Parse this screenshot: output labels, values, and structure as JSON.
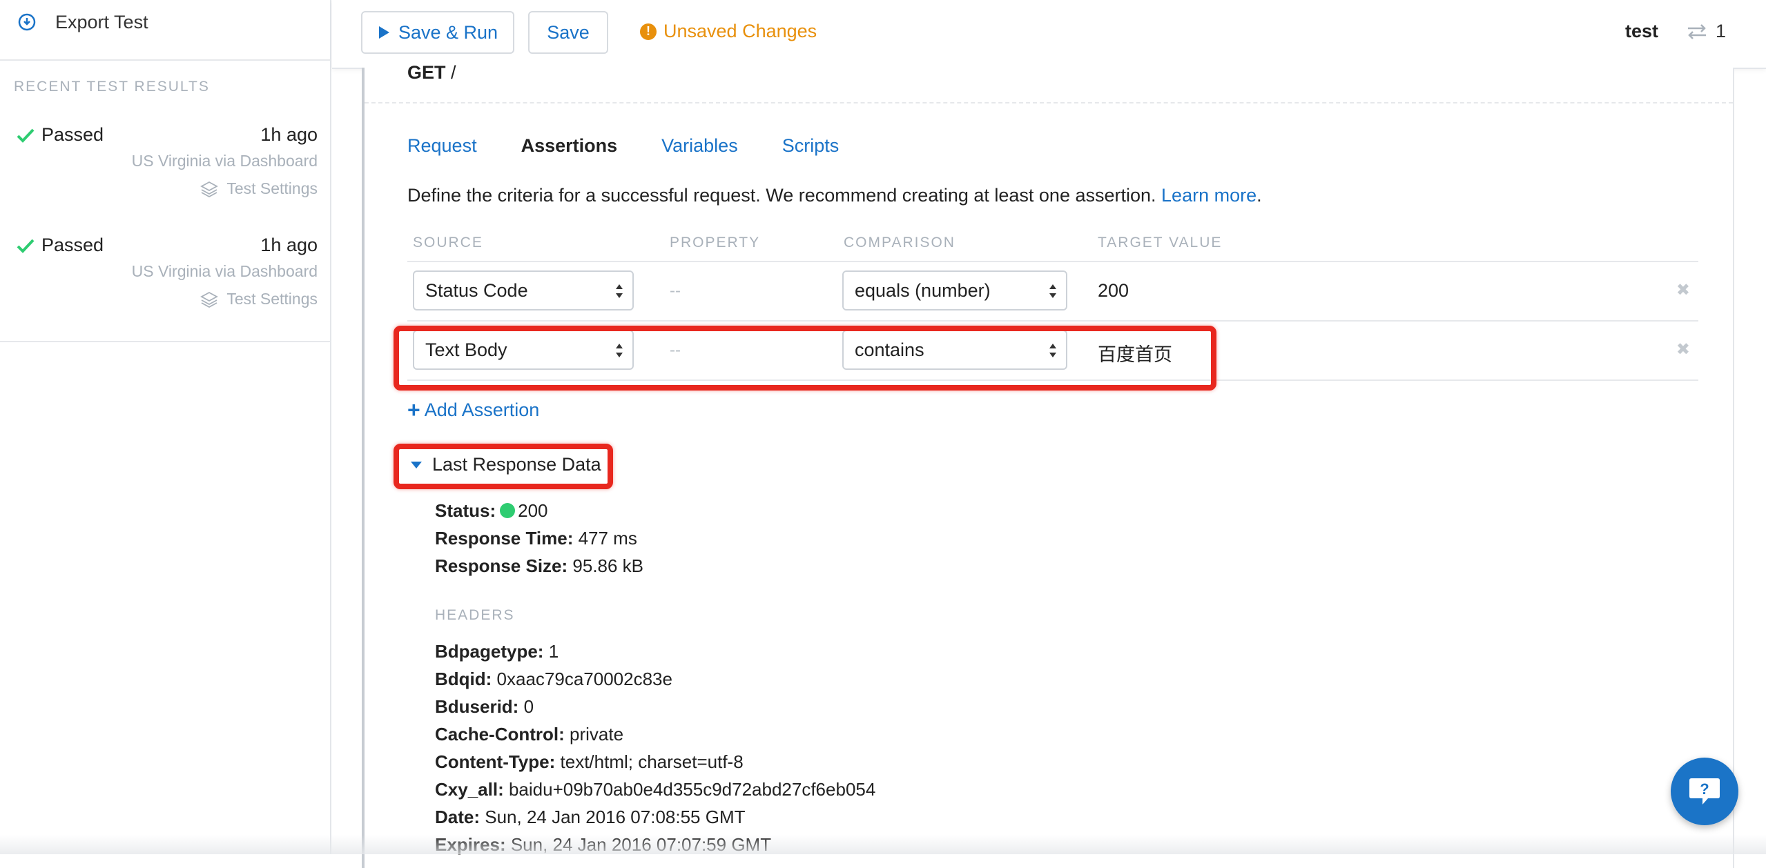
{
  "sidebar": {
    "export_label": "Export Test",
    "recent_heading": "RECENT TEST RESULTS",
    "results": [
      {
        "status": "Passed",
        "time": "1h ago",
        "location": "US Virginia via Dashboard",
        "settings": "Test Settings"
      },
      {
        "status": "Passed",
        "time": "1h ago",
        "location": "US Virginia via Dashboard",
        "settings": "Test Settings"
      }
    ]
  },
  "topbar": {
    "save_run_label": "Save & Run",
    "save_label": "Save",
    "unsaved_label": "Unsaved Changes",
    "env_name": "test",
    "step_count": "1"
  },
  "request": {
    "method": "GET",
    "path": " /"
  },
  "tabs": [
    {
      "label": "Request",
      "active": false
    },
    {
      "label": "Assertions",
      "active": true
    },
    {
      "label": "Variables",
      "active": false
    },
    {
      "label": "Scripts",
      "active": false
    }
  ],
  "assertions": {
    "description": "Define the criteria for a successful request. We recommend creating at least one assertion. ",
    "learn_more": "Learn more",
    "period": ".",
    "columns": {
      "source": "SOURCE",
      "property": "PROPERTY",
      "comparison": "COMPARISON",
      "target": "TARGET VALUE"
    },
    "rows": [
      {
        "source": "Status Code",
        "property": "--",
        "comparison": "equals (number)",
        "target": "200",
        "delete": "✖"
      },
      {
        "source": "Text Body",
        "property": "--",
        "comparison": "contains",
        "target": "百度首页",
        "delete": "✖"
      }
    ],
    "add_label": "Add Assertion"
  },
  "last_response": {
    "heading": "Last Response Data",
    "status_label": "Status:",
    "status_value": "200",
    "time_label": "Response Time:",
    "time_value": " 477 ms",
    "size_label": "Response Size:",
    "size_value": " 95.86 kB",
    "headers_heading": "HEADERS",
    "headers": [
      {
        "key": "Bdpagetype:",
        "value": " 1"
      },
      {
        "key": "Bdqid:",
        "value": " 0xaac79ca70002c83e"
      },
      {
        "key": "Bduserid:",
        "value": " 0"
      },
      {
        "key": "Cache-Control:",
        "value": " private"
      },
      {
        "key": "Content-Type:",
        "value": " text/html; charset=utf-8"
      },
      {
        "key": "Cxy_all:",
        "value": " baidu+09b70ab0e4d355c9d72abd27cf6eb054"
      },
      {
        "key": "Date:",
        "value": " Sun, 24 Jan 2016 07:08:55 GMT"
      },
      {
        "key": "Expires:",
        "value": " Sun, 24 Jan 2016 07:07:59 GMT"
      }
    ]
  },
  "colors": {
    "link": "#1a73c8",
    "warning": "#e8900c",
    "success": "#2ecc71",
    "highlight": "#e8271e",
    "help_button": "#1b74c7"
  },
  "icons": [
    "download-circle-icon",
    "check-icon",
    "layers-icon",
    "play-icon",
    "warning-icon",
    "steps-arrows-icon",
    "select-arrows-icon",
    "close-icon",
    "plus-icon",
    "caret-down-icon",
    "help-chat-icon"
  ]
}
